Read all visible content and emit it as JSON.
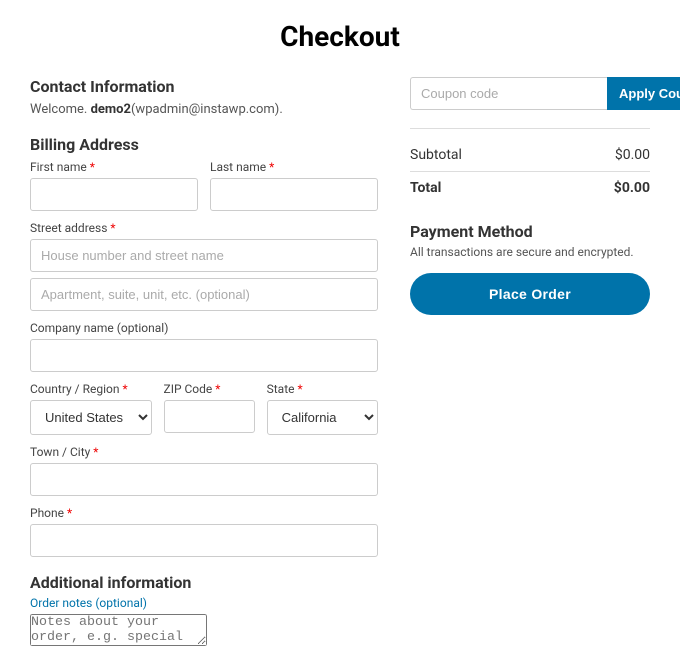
{
  "page": {
    "title": "Checkout"
  },
  "contact": {
    "section_title": "Contact Information",
    "welcome_text": "Welcome. ",
    "username": "demo2",
    "email": "(wpadmin@instawp.com)."
  },
  "billing": {
    "section_title": "Billing Address",
    "first_name": {
      "label": "First name",
      "required": true,
      "value": "",
      "placeholder": ""
    },
    "last_name": {
      "label": "Last name",
      "required": true,
      "value": "",
      "placeholder": ""
    },
    "street_address": {
      "label": "Street address",
      "required": true,
      "placeholder1": "House number and street name",
      "placeholder2": "Apartment, suite, unit, etc. (optional)"
    },
    "company": {
      "label": "Company name (optional)",
      "value": "",
      "placeholder": ""
    },
    "country": {
      "label": "Country / Region",
      "required": true,
      "selected": "United States (..."
    },
    "zip": {
      "label": "ZIP Code",
      "required": true,
      "value": "",
      "placeholder": ""
    },
    "state": {
      "label": "State",
      "required": true,
      "selected": "California"
    },
    "city": {
      "label": "Town / City",
      "required": true,
      "value": "",
      "placeholder": ""
    },
    "phone": {
      "label": "Phone",
      "required": true,
      "value": "",
      "placeholder": ""
    }
  },
  "additional": {
    "section_title": "Additional information",
    "notes_label": "Order notes (optional)",
    "notes_placeholder": "Notes about your order, e.g. special notes for delivery."
  },
  "coupon": {
    "placeholder": "Coupon code",
    "button_label": "Apply Coupon"
  },
  "order_summary": {
    "subtotal_label": "Subtotal",
    "subtotal_value": "$0.00",
    "total_label": "Total",
    "total_value": "$0.00"
  },
  "payment": {
    "section_title": "Payment Method",
    "secure_text": "All transactions are secure and encrypted.",
    "place_order_label": "Place Order"
  }
}
